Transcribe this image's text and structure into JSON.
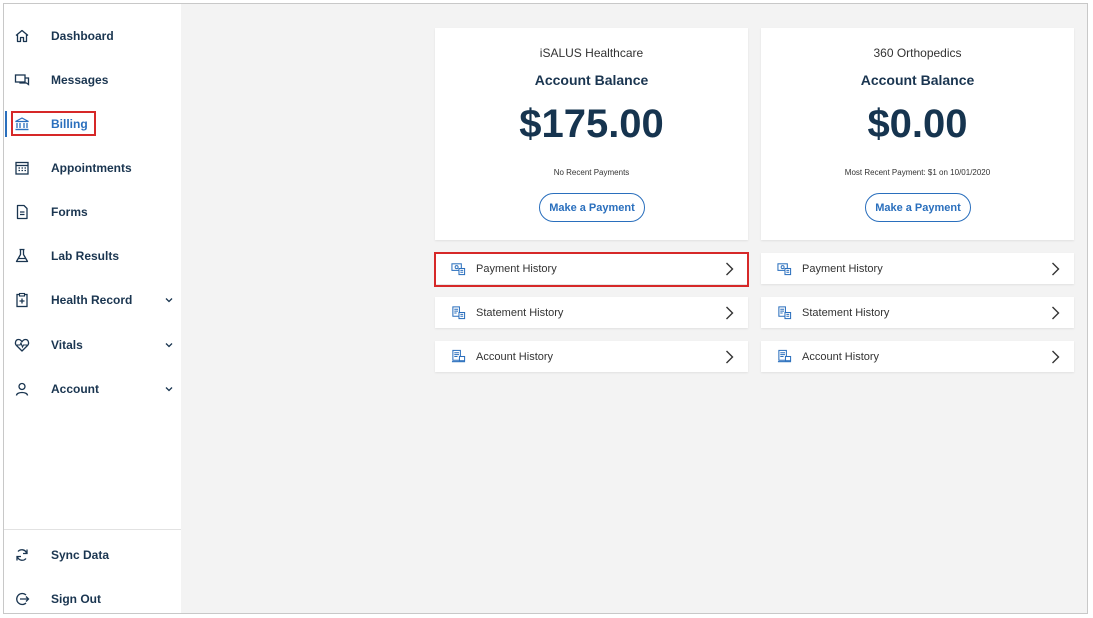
{
  "sidebar": {
    "items": [
      {
        "label": "Dashboard",
        "icon": "home-icon"
      },
      {
        "label": "Messages",
        "icon": "chat-icon"
      },
      {
        "label": "Billing",
        "icon": "bank-icon",
        "active": true
      },
      {
        "label": "Appointments",
        "icon": "calendar-icon"
      },
      {
        "label": "Forms",
        "icon": "document-icon"
      },
      {
        "label": "Lab Results",
        "icon": "flask-icon"
      },
      {
        "label": "Health Record",
        "icon": "clipboard-icon",
        "expandable": true
      },
      {
        "label": "Vitals",
        "icon": "heart-pulse-icon",
        "expandable": true
      },
      {
        "label": "Account",
        "icon": "user-icon",
        "expandable": true
      }
    ],
    "bottom_items": [
      {
        "label": "Sync Data",
        "icon": "sync-icon"
      },
      {
        "label": "Sign Out",
        "icon": "sign-out-icon"
      }
    ]
  },
  "accounts": [
    {
      "provider": "iSALUS Healthcare",
      "title": "Account Balance",
      "amount": "$175.00",
      "note": "No Recent Payments",
      "button": "Make a Payment",
      "rows": [
        {
          "label": "Payment History",
          "icon": "payment-history-icon"
        },
        {
          "label": "Statement History",
          "icon": "statement-history-icon"
        },
        {
          "label": "Account History",
          "icon": "account-history-icon"
        }
      ]
    },
    {
      "provider": "360 Orthopedics",
      "title": "Account Balance",
      "amount": "$0.00",
      "note": "Most Recent Payment: $1 on 10/01/2020",
      "button": "Make a Payment",
      "rows": [
        {
          "label": "Payment History",
          "icon": "payment-history-icon"
        },
        {
          "label": "Statement History",
          "icon": "statement-history-icon"
        },
        {
          "label": "Account History",
          "icon": "account-history-icon"
        }
      ]
    }
  ],
  "colors": {
    "accent": "#2a6fbd",
    "navy": "#1a3550",
    "highlight": "#d62828",
    "background": "#f3f3f3"
  }
}
